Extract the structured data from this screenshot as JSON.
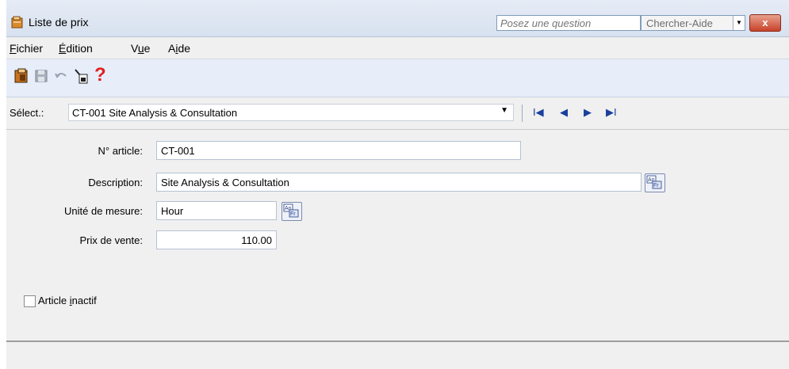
{
  "window": {
    "title": "Liste de prix"
  },
  "help": {
    "ask_placeholder": "Posez une question",
    "search_label": "Chercher-Aide",
    "close_label": "x"
  },
  "menu": [
    {
      "pre": "",
      "ul": "F",
      "post": "ichier"
    },
    {
      "pre": "",
      "ul": "É",
      "post": "dition"
    },
    {
      "pre": "V",
      "ul": "u",
      "post": "e"
    },
    {
      "pre": "A",
      "ul": "i",
      "post": "de"
    }
  ],
  "toolbar": {
    "help_glyph": "?"
  },
  "selector": {
    "label": "Sélect.:",
    "value": "CT-001  Site Analysis & Consultation"
  },
  "nav": {
    "first": "I◀",
    "prev": "◀",
    "next": "▶",
    "last": "▶I"
  },
  "form": {
    "article_no_label": "N° article:",
    "article_no": "CT-001",
    "description_label": "Description:",
    "description": "Site Analysis & Consultation",
    "unit_label": "Unité de mesure:",
    "unit": "Hour",
    "price_label": "Prix de vente:",
    "price": "110.00"
  },
  "inactive": {
    "label_pre": "Article ",
    "label_ul": "i",
    "label_post": "nactif",
    "checked": false
  },
  "translate": {
    "top": "An",
    "bottom": "Fr"
  }
}
